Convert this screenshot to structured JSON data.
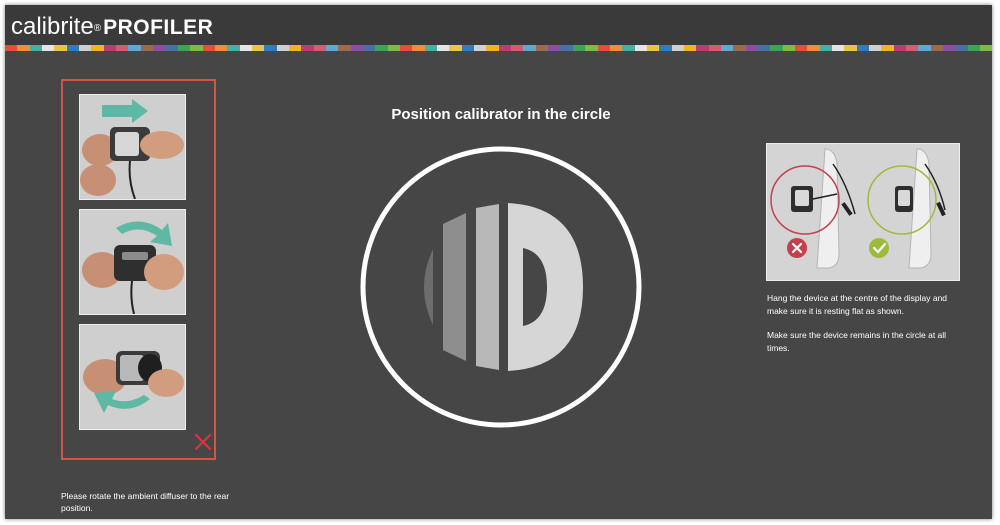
{
  "app": {
    "brand_name": "calibrite",
    "brand_mark": "®",
    "product_name": "PROFILER"
  },
  "colors": {
    "background": "#464646",
    "header": "#3a3a3a",
    "frame_accent": "#d9543f",
    "wrong_circle": "#c4404d",
    "right_circle": "#9dbb3a"
  },
  "color_strip": [
    "#e84d3c",
    "#f0b323",
    "#3aa655",
    "#2d7dc0",
    "#8a4fa0",
    "#e4e4e4",
    "#5fa8d3",
    "#f28c38",
    "#b83e6f",
    "#7dbb42",
    "#cfcfcf",
    "#4a6fa5",
    "#e8c547",
    "#9c6b4e",
    "#48b0a0",
    "#d35d6e"
  ],
  "steps": {
    "frame_name": "ambient-diffuser-steps",
    "step_icons": [
      "arrow-right-icon",
      "rotate-arrow-icon",
      "rotate-arrow-icon"
    ],
    "close_icon": "close-icon",
    "note": "Please rotate the ambient diffuser to the rear position."
  },
  "main": {
    "title": "Position calibrator in the circle",
    "target_icon": "calibrite-logo-icon"
  },
  "guide": {
    "icons": [
      "wrong-icon",
      "correct-icon"
    ],
    "paragraph_1": "Hang the device at the centre of the display and make sure it is resting flat as shown.",
    "paragraph_2": "Make sure the device remains in the circle at all times."
  }
}
